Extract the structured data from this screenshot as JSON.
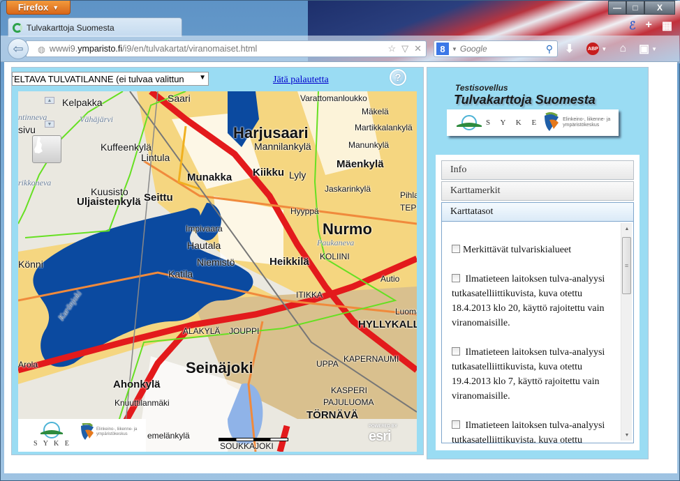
{
  "browser": {
    "menu_button": "Firefox",
    "tab_title": "Tulvakarttoja Suomesta",
    "url_prefix": "wwwi9.",
    "url_domain": "ymparisto.fi",
    "url_path": "/i9/en/tulvakartat/viranomaiset.html",
    "search_engine_icon": "8",
    "search_placeholder": "Google",
    "window_controls": {
      "minimize": "—",
      "maximize": "□",
      "close": "X"
    },
    "toolbar_icons": [
      "download-icon",
      "adblock-icon",
      "home-icon",
      "bookmarks-icon"
    ],
    "abp_label": "ABP"
  },
  "map_panel": {
    "scenario_select": "TELTAVA TULVATILANNE (ei tulvaa valittun",
    "feedback_link": "Jätä palautetta",
    "help_icon": "?",
    "labels": [
      {
        "t": "Kelpakka",
        "c": "m"
      },
      {
        "t": "Saari",
        "c": "m"
      },
      {
        "t": "Vähäjärvi",
        "c": "it"
      },
      {
        "t": "ntinneva",
        "c": "it"
      },
      {
        "t": "sivu",
        "c": "m"
      },
      {
        "t": "Harjusaari",
        "c": "xl"
      },
      {
        "t": "Varattomanloukko",
        "c": "s"
      },
      {
        "t": "Mäkelä",
        "c": "s"
      },
      {
        "t": "Martikkalankylä",
        "c": "s"
      },
      {
        "t": "Manunkylä",
        "c": "s"
      },
      {
        "t": "Mannilankylä",
        "c": "m"
      },
      {
        "t": "Kuffeenkylä",
        "c": "m"
      },
      {
        "t": "Lintula",
        "c": "m"
      },
      {
        "t": "Munakka",
        "c": "b"
      },
      {
        "t": "Kiikku",
        "c": "b"
      },
      {
        "t": "Lyly",
        "c": "m"
      },
      {
        "t": "Mäenkylä",
        "c": "b"
      },
      {
        "t": "Jaskarinkylä",
        "c": "s"
      },
      {
        "t": "Pihlajam",
        "c": "s"
      },
      {
        "t": "TEPI",
        "c": "s"
      },
      {
        "t": "rikkoneva",
        "c": "it"
      },
      {
        "t": "Kuusisto",
        "c": "m"
      },
      {
        "t": "Uljaistenkylä",
        "c": "b"
      },
      {
        "t": "Seittu",
        "c": "b"
      },
      {
        "t": "Hyyppä",
        "c": "s"
      },
      {
        "t": "Nurmo",
        "c": "xl"
      },
      {
        "t": "Paukaneva",
        "c": "it"
      },
      {
        "t": "Impivaara",
        "c": "s"
      },
      {
        "t": "Hautala",
        "c": "m"
      },
      {
        "t": "Niemistö",
        "c": "m"
      },
      {
        "t": "Heikkilä",
        "c": "b"
      },
      {
        "t": "KOLIINI",
        "c": "s"
      },
      {
        "t": "Könni",
        "c": "m"
      },
      {
        "t": "Katila",
        "c": "m"
      },
      {
        "t": "Autio",
        "c": "s"
      },
      {
        "t": "ITIKKA",
        "c": "s"
      },
      {
        "t": "Luoma",
        "c": "s"
      },
      {
        "t": "HYLLYKALLI",
        "c": "b"
      },
      {
        "t": "ALAKYLÄ",
        "c": "s"
      },
      {
        "t": "JOUPPI",
        "c": "s"
      },
      {
        "t": "Kurönjoki",
        "c": "it"
      },
      {
        "t": "Seinäjoki",
        "c": "xl"
      },
      {
        "t": "UPPA",
        "c": "s"
      },
      {
        "t": "KAPERNAUMI",
        "c": "s"
      },
      {
        "t": "Ahonkylä",
        "c": "b"
      },
      {
        "t": "Knuuttilanmäki",
        "c": "s"
      },
      {
        "t": "KASPERI",
        "c": "s"
      },
      {
        "t": "PAJULUOMA",
        "c": "s"
      },
      {
        "t": "TÖRNÄVÄ",
        "c": "b"
      },
      {
        "t": "emelänkylä",
        "c": "s"
      },
      {
        "t": "SOUKKAJOKI",
        "c": "s"
      },
      {
        "t": "Arola",
        "c": "s"
      }
    ],
    "logo_syke": "S Y K E",
    "logo_ely": "Elinkeino-, liikenne- ja ympäristökeskus",
    "esri_powered": "POWERED BY",
    "esri_name": "esri"
  },
  "side_panel": {
    "subtitle": "Testisovellus",
    "title": "Tulvakarttoja Suomesta",
    "logo_syke": "S Y K E",
    "logo_ely_line1": "Elinkeino-, liikenne- ja",
    "logo_ely_line2": "ympäristökeskus",
    "accordion": [
      {
        "label": "Info",
        "active": false
      },
      {
        "label": "Karttamerkit",
        "active": false
      },
      {
        "label": "Karttatasot",
        "active": true
      }
    ],
    "layers": [
      {
        "label": "Merkittävät tulvariskialueet",
        "checked": false
      },
      {
        "label": "Ilmatieteen laitoksen tulva-analyysi tutkasatelliittikuvista, kuva otettu 18.4.2013 klo 20, käyttö rajoitettu vain viranomaisille.",
        "checked": false
      },
      {
        "label": "Ilmatieteen laitoksen tulva-analyysi tutkasatelliittikuvista, kuva otettu 19.4.2013 klo 7, käyttö rajoitettu vain viranomaisille.",
        "checked": false
      },
      {
        "label": "Ilmatieteen laitoksen tulva-analyysi tutkasatelliittikuvista, kuva otettu",
        "checked": false
      }
    ]
  }
}
